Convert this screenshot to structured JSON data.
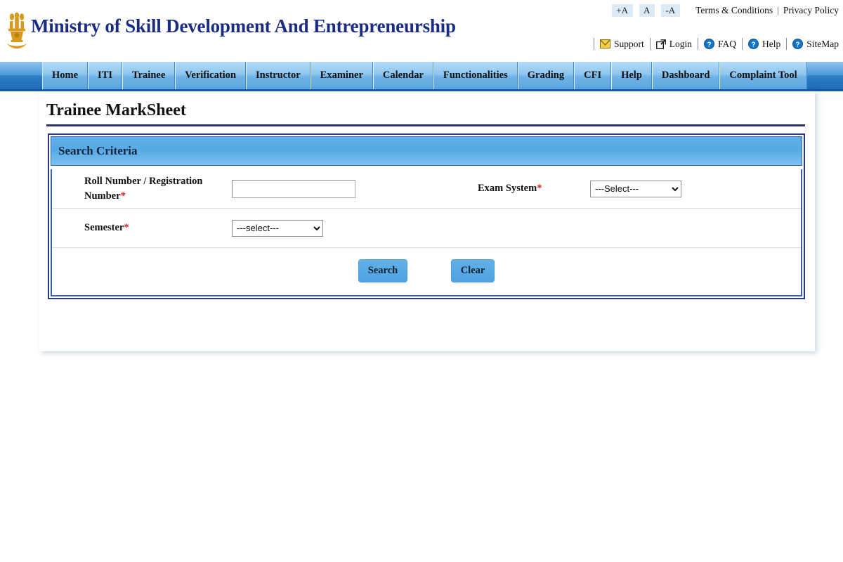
{
  "header": {
    "site_title": "Ministry of Skill Development And Entrepreneurship",
    "emblem_icon": "india-state-emblem-icon",
    "font_size_controls": [
      {
        "label": "+A",
        "name": "increase-font"
      },
      {
        "label": "A",
        "name": "default-font"
      },
      {
        "label": "-A",
        "name": "decrease-font"
      }
    ],
    "top_links": [
      {
        "label": "Terms & Conditions"
      },
      {
        "label": "Privacy Policy"
      }
    ],
    "top_link_separator": "|",
    "util_links": [
      {
        "label": "Support",
        "icon": "support-envelope-icon"
      },
      {
        "label": "Login",
        "icon": "external-link-icon"
      },
      {
        "label": "FAQ",
        "icon": "question-circle-icon"
      },
      {
        "label": "Help",
        "icon": "question-circle-icon"
      },
      {
        "label": "SiteMap",
        "icon": "question-circle-icon"
      }
    ]
  },
  "nav": {
    "items": [
      {
        "label": "Home"
      },
      {
        "label": "ITI"
      },
      {
        "label": "Trainee"
      },
      {
        "label": "Verification"
      },
      {
        "label": "Instructor"
      },
      {
        "label": "Examiner"
      },
      {
        "label": "Calendar"
      },
      {
        "label": "Functionalities"
      },
      {
        "label": "Grading"
      },
      {
        "label": "CFI"
      },
      {
        "label": "Help"
      },
      {
        "label": "Dashboard"
      },
      {
        "label": "Complaint Tool"
      }
    ]
  },
  "main": {
    "page_title": "Trainee MarkSheet",
    "panel_title": "Search Criteria",
    "fields": {
      "roll_number": {
        "label_line1": "Roll Number / Registration",
        "label_line2": "Number",
        "required_mark": "*",
        "value": "",
        "placeholder": ""
      },
      "exam_system": {
        "label": "Exam System",
        "required_mark": "*",
        "selected": "---Select---",
        "options": [
          "---Select---"
        ]
      },
      "semester": {
        "label": "Semester",
        "required_mark": "*",
        "selected": "---select---",
        "options": [
          "---select---"
        ]
      }
    },
    "buttons": {
      "search": "Search",
      "clear": "Clear"
    }
  },
  "colors": {
    "brand_navy": "#1b2d83",
    "nav_blue": "#4a9ad9",
    "panel_border": "#2b3a86",
    "button_blue": "#4ea3e2",
    "required_red": "#d02020"
  }
}
